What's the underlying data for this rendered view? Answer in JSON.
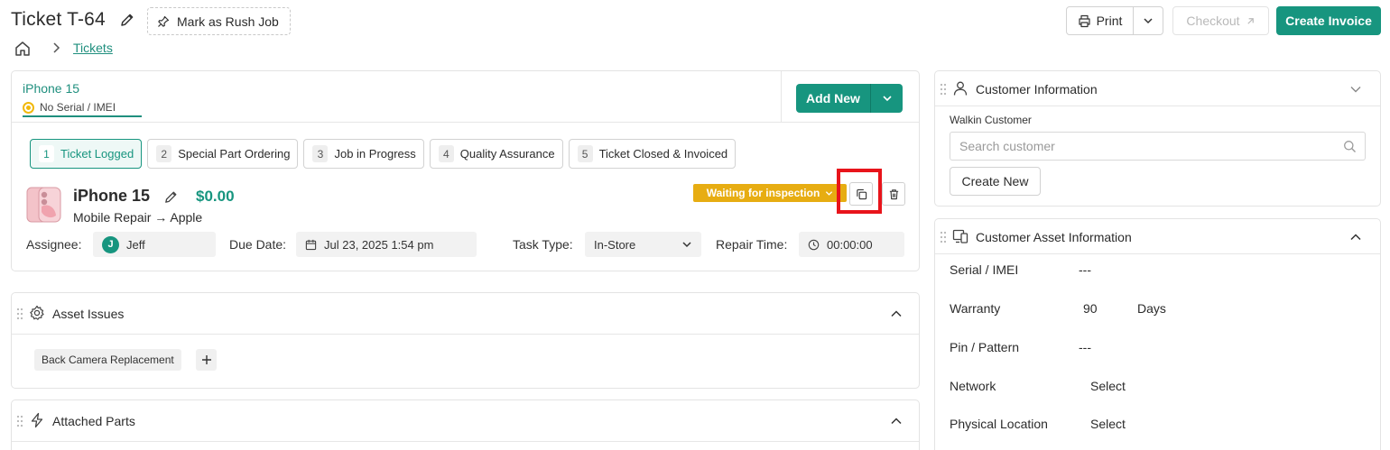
{
  "header": {
    "title": "Ticket T-64",
    "rush_label": "Mark as Rush Job",
    "breadcrumb_link": "Tickets",
    "print_label": "Print",
    "checkout_label": "Checkout",
    "create_invoice_label": "Create Invoice"
  },
  "device_tab": {
    "name": "iPhone 15",
    "serial": "No Serial / IMEI",
    "add_new_label": "Add New"
  },
  "steps": [
    {
      "num": "1",
      "label": "Ticket Logged",
      "active": true
    },
    {
      "num": "2",
      "label": "Special Part Ordering",
      "active": false
    },
    {
      "num": "3",
      "label": "Job in Progress",
      "active": false
    },
    {
      "num": "4",
      "label": "Quality Assurance",
      "active": false
    },
    {
      "num": "5",
      "label": "Ticket Closed & Invoiced",
      "active": false
    }
  ],
  "item": {
    "name": "iPhone 15",
    "price": "$0.00",
    "path": "Mobile Repair → Apple",
    "status": "Waiting for inspection"
  },
  "fields": {
    "assignee_label": "Assignee:",
    "assignee_initial": "J",
    "assignee_name": "Jeff",
    "due_label": "Due Date:",
    "due_value": "Jul 23, 2025 1:54 pm",
    "task_label": "Task Type:",
    "task_value": "In-Store",
    "repair_label": "Repair Time:",
    "repair_value": "00:00:00"
  },
  "issues": {
    "title": "Asset Issues",
    "chips": [
      "Back Camera Replacement"
    ]
  },
  "parts": {
    "title": "Attached Parts"
  },
  "customer": {
    "title": "Customer Information",
    "walkin_label": "Walkin Customer",
    "search_placeholder": "Search customer",
    "create_new_label": "Create New"
  },
  "asset": {
    "title": "Customer Asset Information",
    "serial_label": "Serial / IMEI",
    "serial_value": "---",
    "warranty_label": "Warranty",
    "warranty_value": "90",
    "warranty_unit": "Days",
    "pin_label": "Pin / Pattern",
    "pin_value": "---",
    "network_label": "Network",
    "network_value": "Select",
    "location_label": "Physical Location",
    "location_value": "Select"
  },
  "colors": {
    "accent": "#17957f",
    "status": "#e7ad12",
    "highlight": "#e8141b"
  }
}
